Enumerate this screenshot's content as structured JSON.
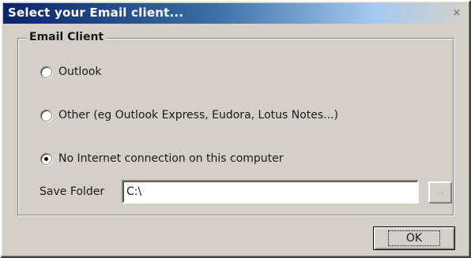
{
  "dialog": {
    "title": "Select your Email client...",
    "close_label": "×"
  },
  "email_client_group": {
    "legend": "Email Client",
    "options": [
      {
        "label": "Outlook",
        "checked": false
      },
      {
        "label": "Other  (eg Outlook Express, Eudora, Lotus Notes...)",
        "checked": false
      },
      {
        "label": "No Internet connection on this computer",
        "checked": true
      }
    ],
    "save_folder": {
      "label": "Save Folder",
      "value": "C:\\",
      "browse_label": "..."
    }
  },
  "buttons": {
    "ok_label": "OK"
  },
  "colors": {
    "titlebar_start": "#0a246a",
    "face": "#d4d0c8"
  }
}
